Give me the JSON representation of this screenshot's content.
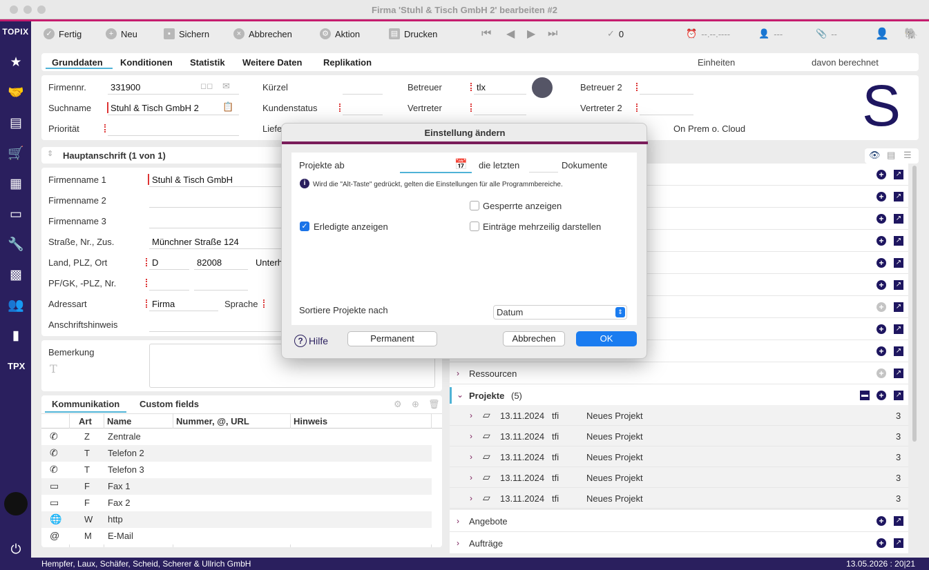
{
  "window": {
    "title": "Firma 'Stuhl & Tisch GmbH 2' bearbeiten #2"
  },
  "sidebar": {
    "logo": "TOPIX",
    "items": [
      {
        "icon": "star-icon",
        "glyph": "★"
      },
      {
        "icon": "handshake-icon",
        "glyph": "🤝"
      },
      {
        "icon": "document-icon",
        "glyph": "▤"
      },
      {
        "icon": "cart-icon",
        "glyph": "🛒"
      },
      {
        "icon": "warehouse-icon",
        "glyph": "▦"
      },
      {
        "icon": "archive-icon",
        "glyph": "▭"
      },
      {
        "icon": "wrench-icon",
        "glyph": "🔧"
      },
      {
        "icon": "calculator-icon",
        "glyph": "▩"
      },
      {
        "icon": "people-icon",
        "glyph": "👥"
      },
      {
        "icon": "chart-icon",
        "glyph": "▮"
      },
      {
        "icon": "tpx-icon",
        "glyph": "TPX"
      }
    ],
    "power_icon": "power-icon",
    "power_glyph": "⏻"
  },
  "toolbar": {
    "fertig": "Fertig",
    "neu": "Neu",
    "sichern": "Sichern",
    "abbrechen": "Abbrechen",
    "aktion": "Aktion",
    "drucken": "Drucken",
    "count": "0",
    "date": "--.--.----",
    "user": "---",
    "attach": "--"
  },
  "tabs": [
    "Grunddaten",
    "Konditionen",
    "Statistik",
    "Weitere Daten",
    "Replikation"
  ],
  "tabs_right": {
    "einheiten": "Einheiten",
    "berechnet": "davon berechnet"
  },
  "header": {
    "firmennr_label": "Firmennr.",
    "firmennr": "331900",
    "suchname_label": "Suchname",
    "suchname": "Stuhl & Tisch GmbH 2",
    "prioritaet_label": "Priorität",
    "kuerzel_label": "Kürzel",
    "kundenstatus_label": "Kundenstatus",
    "liefer_label": "Liefe",
    "betreuer_label": "Betreuer",
    "betreuer": "tlx",
    "vertreter_label": "Vertreter",
    "betreuer2_label": "Betreuer 2",
    "vertreter2_label": "Vertreter 2",
    "cloud_label": "On Prem o. Cloud",
    "avatar_letter": "S"
  },
  "anschrift": {
    "title": "Hauptanschrift (1 von 1)",
    "firmenname1_label": "Firmenname 1",
    "firmenname1": "Stuhl & Tisch GmbH",
    "firmenname2_label": "Firmenname 2",
    "firmenname3_label": "Firmenname 3",
    "strasse_label": "Straße, Nr., Zus.",
    "strasse": "Münchner Straße 124",
    "land_label": "Land, PLZ, Ort",
    "land": "D",
    "plz": "82008",
    "ort": "Unterh",
    "pf_label": "PF/GK, -PLZ, Nr.",
    "adressart_label": "Adressart",
    "adressart": "Firma",
    "sprache_label": "Sprache",
    "hinweis_label": "Anschriftshinweis"
  },
  "bemerkung": {
    "label": "Bemerkung"
  },
  "kommunikation": {
    "tabs": [
      "Kommunikation",
      "Custom fields"
    ],
    "columns": [
      "Art",
      "Name",
      "Nummer, @, URL",
      "Hinweis"
    ],
    "rows": [
      {
        "icon": "phone-icon",
        "glyph": "✆",
        "art": "Z",
        "name": "Zentrale"
      },
      {
        "icon": "phone-icon",
        "glyph": "✆",
        "art": "T",
        "name": "Telefon 2"
      },
      {
        "icon": "phone-icon",
        "glyph": "✆",
        "art": "T",
        "name": "Telefon 3"
      },
      {
        "icon": "fax-icon",
        "glyph": "▭",
        "art": "F",
        "name": "Fax 1"
      },
      {
        "icon": "fax-icon",
        "glyph": "▭",
        "art": "F",
        "name": "Fax 2"
      },
      {
        "icon": "globe-icon",
        "glyph": "🌐",
        "art": "W",
        "name": "http"
      },
      {
        "icon": "at-icon",
        "glyph": "@",
        "art": "M",
        "name": "E-Mail"
      }
    ]
  },
  "right_panel": {
    "ressourcen": "Ressourcen",
    "projekte": "Projekte",
    "projekte_count": "(5)",
    "projects": [
      {
        "date": "13.11.2024",
        "user": "tfi",
        "name": "Neues Projekt",
        "n": "3"
      },
      {
        "date": "13.11.2024",
        "user": "tfi",
        "name": "Neues Projekt",
        "n": "3"
      },
      {
        "date": "13.11.2024",
        "user": "tfi",
        "name": "Neues Projekt",
        "n": "3"
      },
      {
        "date": "13.11.2024",
        "user": "tfi",
        "name": "Neues Projekt",
        "n": "3"
      },
      {
        "date": "13.11.2024",
        "user": "tfi",
        "name": "Neues Projekt",
        "n": "3"
      }
    ],
    "angebote": "Angebote",
    "auftraege": "Aufträge"
  },
  "dialog": {
    "title": "Einstellung ändern",
    "projekte_ab": "Projekte ab",
    "die_letzten": "die letzten",
    "dokumente": "Dokumente",
    "info": "Wird die \"Alt-Taste\" gedrückt, gelten die Einstellungen für alle Programmbereiche.",
    "gesperrte": "Gesperrte anzeigen",
    "erledigte": "Erledigte anzeigen",
    "mehrzeilig": "Einträge mehrzeilig darstellen",
    "sortiere": "Sortiere Projekte nach",
    "sort_value": "Datum",
    "hilfe": "Hilfe",
    "permanent": "Permanent",
    "abbrechen": "Abbrechen",
    "ok": "OK",
    "erledigte_checked": true,
    "gesperrte_checked": false,
    "mehrzeilig_checked": false
  },
  "statusbar": {
    "company": "Hempfer, Laux, Schäfer, Scheid, Scherer & Ullrich GmbH",
    "datetime": "13.05.2026 : 20|21"
  },
  "colors": {
    "sidebar": "#2a1f5e",
    "accent": "#c51d6e",
    "ok": "#1a7cf0"
  }
}
